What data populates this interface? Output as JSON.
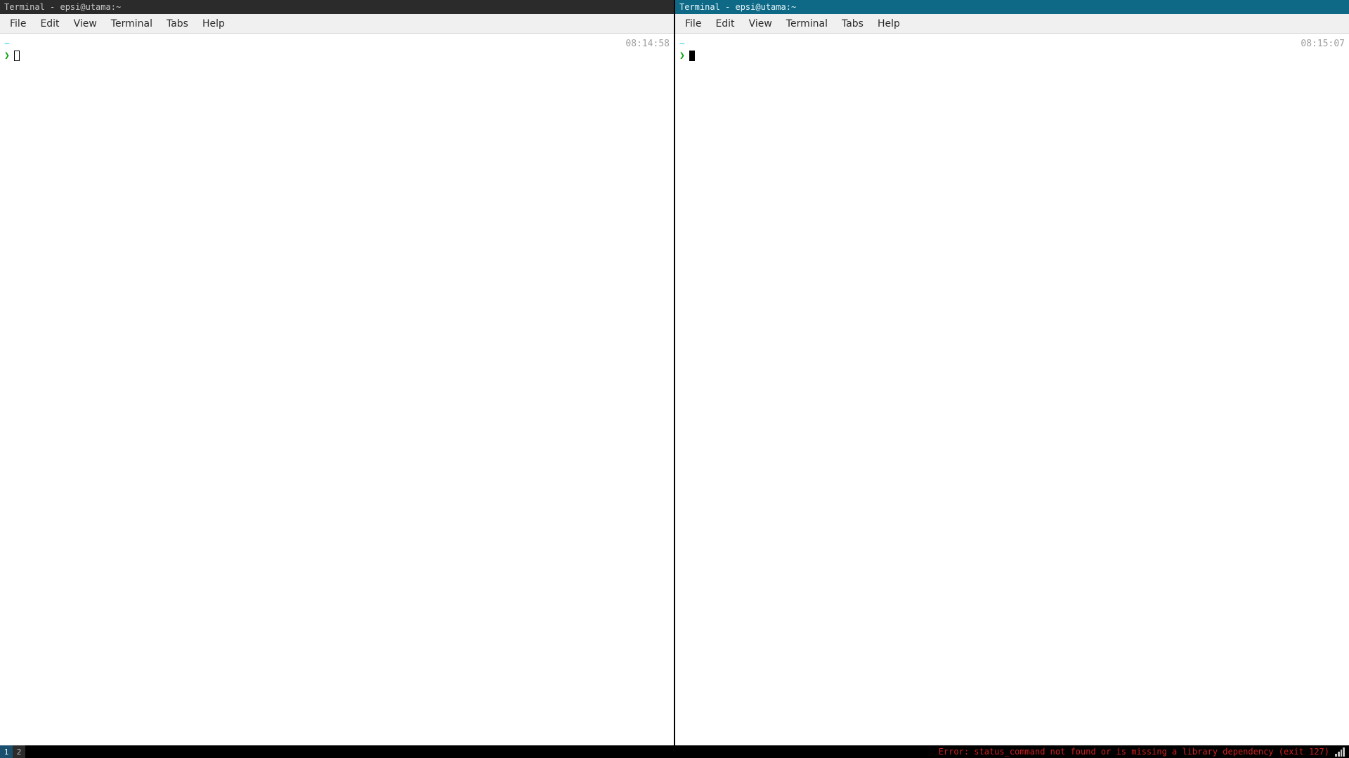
{
  "windows": [
    {
      "title": "Terminal - epsi@utama:~",
      "active": false,
      "timestamp": "08:14:58",
      "prompt_tilde": "~",
      "prompt_chevron": "❯",
      "cursor_style": "outline"
    },
    {
      "title": "Terminal - epsi@utama:~",
      "active": true,
      "timestamp": "08:15:07",
      "prompt_tilde": "~",
      "prompt_chevron": "❯",
      "cursor_style": "solid"
    }
  ],
  "menubar": {
    "items": [
      "File",
      "Edit",
      "View",
      "Terminal",
      "Tabs",
      "Help"
    ]
  },
  "statusbar": {
    "workspaces": [
      {
        "label": "1",
        "current": true
      },
      {
        "label": "2",
        "current": false
      }
    ],
    "error_text": "Error: status_command not found or is missing a library dependency (exit 127)"
  }
}
